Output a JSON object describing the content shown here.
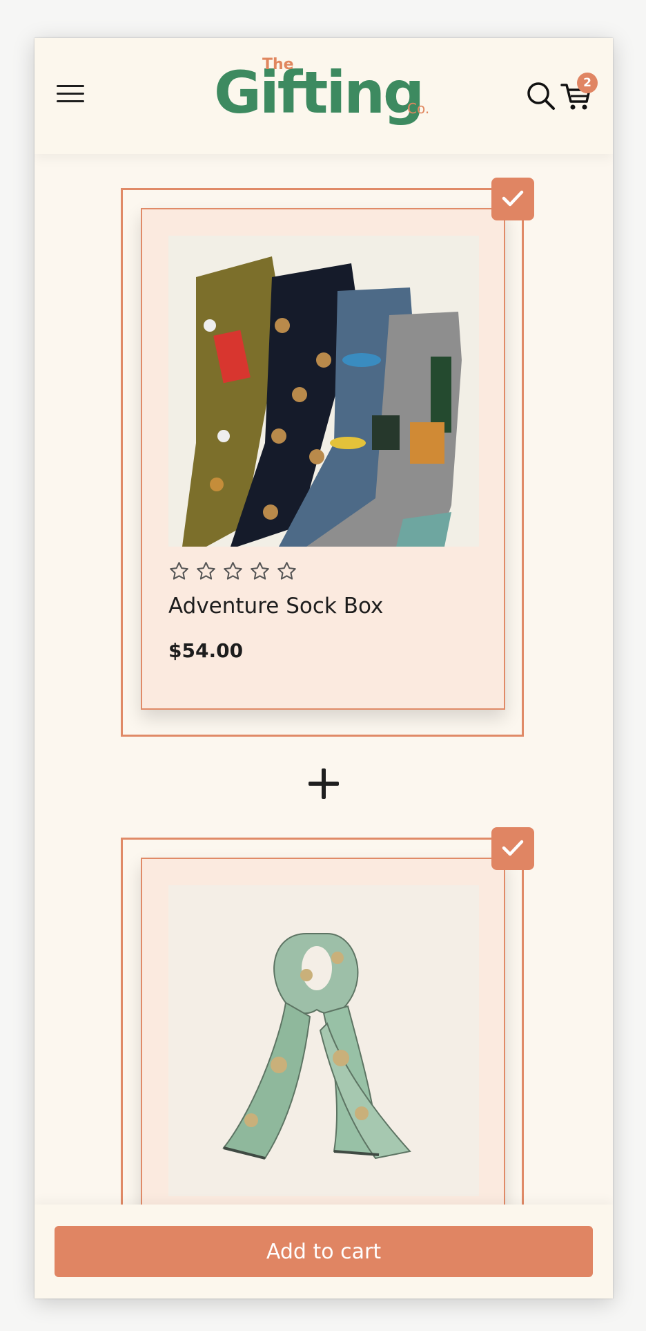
{
  "header": {
    "logo": {
      "the": "The",
      "main": "Gifting",
      "co": "Co."
    },
    "cart_count": "2"
  },
  "products": [
    {
      "name": "Adventure Sock Box",
      "price": "$54.00",
      "rating": 0,
      "selected": true,
      "image": "patterned-socks-photo"
    },
    {
      "name": "",
      "price": "",
      "rating": 0,
      "selected": true,
      "image": "green-printed-scarf-photo"
    }
  ],
  "footer": {
    "add_to_cart_label": "Add to cart"
  },
  "colors": {
    "accent": "#e08563",
    "brand_green": "#3d8a60",
    "card_bg": "#fbeadf",
    "page_bg": "#fcf7ef"
  }
}
